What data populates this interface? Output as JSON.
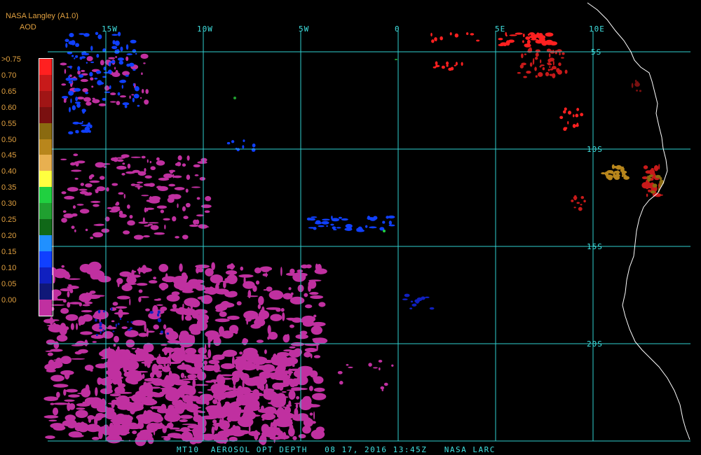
{
  "header": {
    "source": "NASA Langley (A1.0)",
    "parameter": "AOD"
  },
  "color_scale": {
    "labels": [
      ">0.75",
      "0.70",
      "0.65",
      "0.60",
      "0.55",
      "0.50",
      "0.45",
      "0.40",
      "0.35",
      "0.30",
      "0.25",
      "0.20",
      "0.15",
      "0.10",
      "0.05",
      "0.00"
    ],
    "colors": [
      "#ff2020",
      "#c81a1a",
      "#a01515",
      "#7a1010",
      "#8a6a10",
      "#b8861c",
      "#e8b050",
      "#ffff40",
      "#20d040",
      "#20a030",
      "#106818",
      "#2090ff",
      "#1040ff",
      "#1020c0",
      "#101878",
      "#c030a0"
    ]
  },
  "map": {
    "lon_labels": [
      "15W",
      "10W",
      "5W",
      "0",
      "5E",
      "10E"
    ],
    "lat_labels": [
      "5S",
      "10S",
      "15S",
      "20S"
    ]
  },
  "footer": "MT10  AEROSOL OPT DEPTH   08 17, 2016 13:45Z   NASA LARC"
}
